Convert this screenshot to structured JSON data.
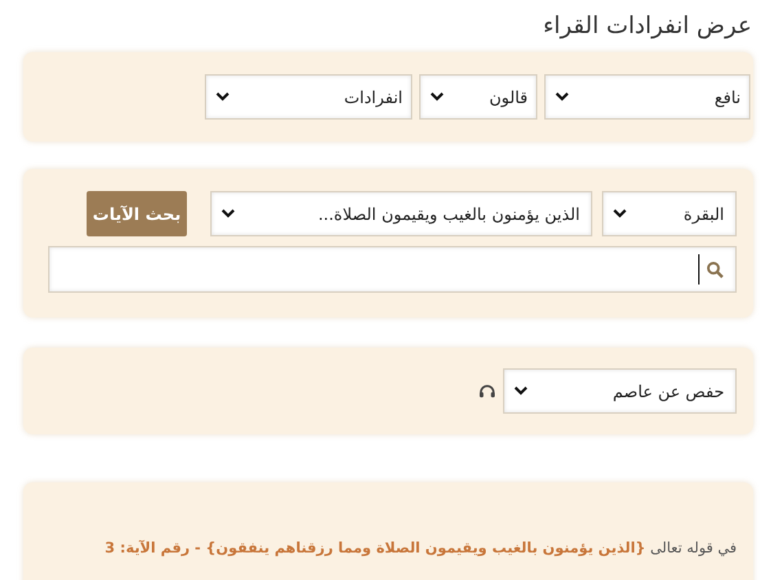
{
  "title": "عرض انفرادات القراء",
  "filters": [
    {
      "value": "نافع"
    },
    {
      "value": "قالون"
    },
    {
      "value": "انفرادات"
    }
  ],
  "search_panel": {
    "surah": "البقرة",
    "ayah": "الذين يؤمنون بالغيب ويقيمون الصلاة...",
    "button": "بحث الآيات"
  },
  "audio": {
    "reciter": "حفص عن عاصم"
  },
  "result": {
    "text": "في قوله تعالى **{الذين يؤمنون بالغيب ويقيمون الصلاة ومما رزقناهم ينفقون} - رقم الآية: 3**"
  }
}
